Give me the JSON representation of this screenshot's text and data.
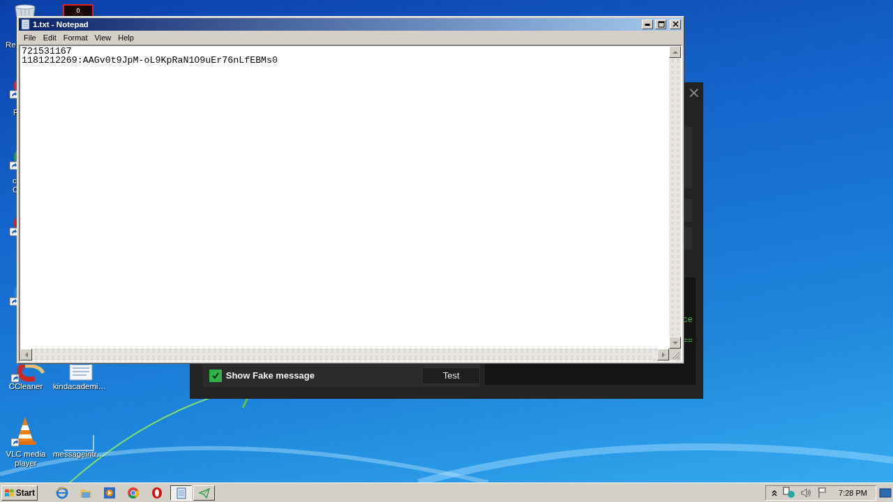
{
  "desktop_icons": [
    {
      "kind": "recycle-bin",
      "lines": [
        "Re"
      ]
    },
    {
      "kind": "counter",
      "icon_text": "0"
    },
    {
      "kind": "app",
      "color": "#e02828",
      "lines": [
        "F"
      ]
    },
    {
      "kind": "app",
      "color": "#2f9e44",
      "lines": [
        "c",
        "C"
      ]
    },
    {
      "kind": "app",
      "color": "#d02020"
    },
    {
      "kind": "app",
      "color": "#1e88e5"
    },
    {
      "kind": "ccleaner",
      "lines": [
        "CCleaner"
      ]
    },
    {
      "kind": "document",
      "lines": [
        "kindacademi…"
      ]
    },
    {
      "kind": "vlc",
      "lines": [
        "VLC media",
        "player"
      ]
    },
    {
      "kind": "blank",
      "lines": [
        "messageintr…"
      ]
    }
  ],
  "app_window": {
    "close": "×",
    "show_fake_message": {
      "label": "Show Fake message",
      "checked": true
    },
    "test_button": "Test",
    "console_lines": [
      "ce",
      "=="
    ]
  },
  "notepad": {
    "title": "1.txt - Notepad",
    "menu": [
      "File",
      "Edit",
      "Format",
      "View",
      "Help"
    ],
    "lines": [
      "721531167",
      "1181212269:AAGv0t9JpM-oL9KpRaN1O9uEr76nLfEBMs0"
    ]
  },
  "taskbar": {
    "start": "Start",
    "quick_launch": [
      {
        "kind": "ie"
      },
      {
        "kind": "folder"
      },
      {
        "kind": "media"
      },
      {
        "kind": "chrome"
      },
      {
        "kind": "opera"
      }
    ],
    "task_buttons": [
      {
        "kind": "notepad",
        "selected": true
      },
      {
        "kind": "telegram",
        "selected": false
      }
    ],
    "clock": "7:28 PM"
  }
}
